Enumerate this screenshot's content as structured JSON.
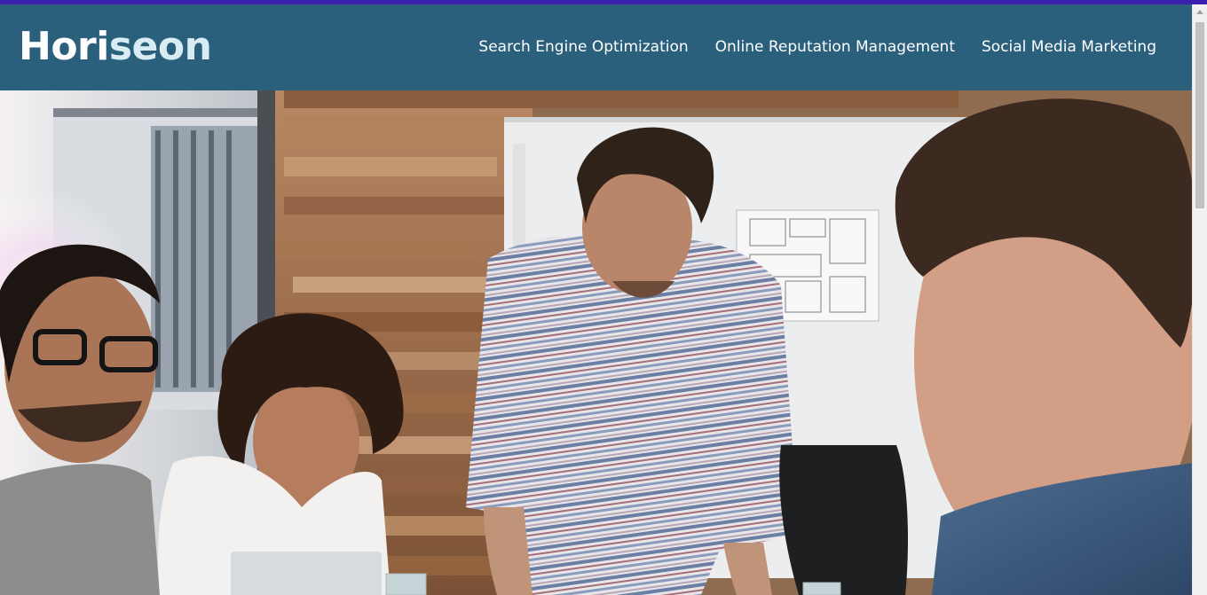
{
  "brand": {
    "part_a": "Hori",
    "part_b": "seon"
  },
  "nav": {
    "items": [
      {
        "label": "Search Engine Optimization"
      },
      {
        "label": "Online Reputation Management"
      },
      {
        "label": "Social Media Marketing"
      }
    ]
  },
  "colors": {
    "header_bg": "#2a607c",
    "top_accent": "#3b1fae",
    "nav_text": "#ffffff"
  }
}
